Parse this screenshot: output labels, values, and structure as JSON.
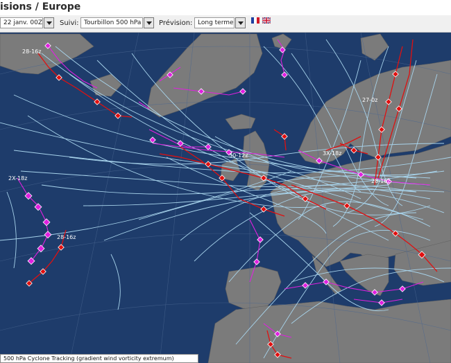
{
  "header": {
    "title": "isions / Europe"
  },
  "toolbar": {
    "date_value": "22 janv. 00Z",
    "follow_label": "Suivi:",
    "follow_value": "Tourbillon 500 hPa",
    "forecast_label": "Prévision:",
    "forecast_value": "Long terme"
  },
  "flags": [
    "french-flag",
    "uk-flag"
  ],
  "map": {
    "colors": {
      "sea": "#1e3c6b",
      "land": "#7a7a7a",
      "track_light": "#a8d4ec",
      "track_red": "#e01010",
      "track_magenta": "#e020e0"
    },
    "labels": [
      "28-16z",
      "28-16z",
      "27-0z",
      "3X-18z",
      "30-12z",
      "28-16z",
      "2X-18z"
    ]
  },
  "caption": "500 hPa Cyclone Tracking (gradient wind vorticity extremum)"
}
